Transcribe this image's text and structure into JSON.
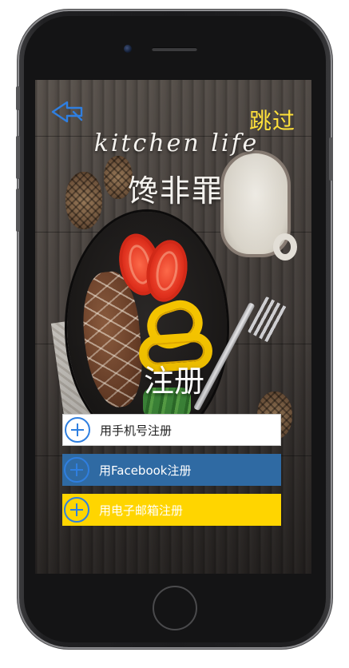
{
  "screen": {
    "skip_label": "跳过",
    "brand_en": "kitchen  life",
    "brand_cn": "馋非罪",
    "register_title": "注册",
    "options": [
      {
        "label": "用手机号注册",
        "icon": "plus-circle-icon"
      },
      {
        "label": "用Facebook注册",
        "icon": "plus-circle-icon"
      },
      {
        "label": "用电子邮箱注册",
        "icon": "plus-circle-icon"
      }
    ],
    "back_icon": "back-arrow-icon"
  },
  "colors": {
    "skip": "#ffe13a",
    "facebook_button": "#2f6aa3",
    "email_button": "#ffd500",
    "phone_button": "#ffffff",
    "icon_blue": "#2f7fe0"
  }
}
